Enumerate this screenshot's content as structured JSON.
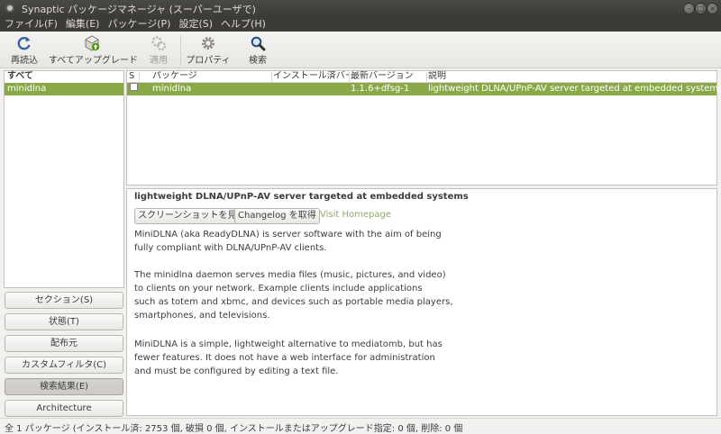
{
  "window": {
    "title": "Synaptic パッケージマネージャ (スーパーユーザで)"
  },
  "menu": [
    "ファイル(F)",
    "編集(E)",
    "パッケージ(P)",
    "設定(S)",
    "ヘルプ(H)"
  ],
  "toolbar": {
    "reload": "再読込",
    "upgrade_all": "すべてアップグレード",
    "apply": "適用",
    "properties": "プロパティ",
    "search": "検索"
  },
  "left": {
    "header": "すべて",
    "items": [
      "minidlna"
    ],
    "buttons": {
      "sections": "セクション(S)",
      "status": "状態(T)",
      "origin": "配布元",
      "custom": "カスタムフィルタ(C)",
      "search_results": "検索結果(E)",
      "architecture": "Architecture"
    }
  },
  "table": {
    "columns": {
      "s": "S",
      "package": "パッケージ",
      "installed": "インストール済バージ",
      "latest": "最新バージョン",
      "description": "説明"
    },
    "rows": [
      {
        "package": "minidlna",
        "installed": "",
        "latest": "1.1.6+dfsg-1",
        "description": "lightweight DLNA/UPnP-AV server targeted at embedded systems"
      }
    ]
  },
  "details": {
    "title": "lightweight DLNA/UPnP-AV server targeted at embedded systems",
    "screenshot_button": "スクリーンショットを見る",
    "changelog_button": "Changelog を取得",
    "homepage_link": "Visit Homepage",
    "paragraph1": "MiniDLNA (aka ReadyDLNA) is server software with the aim of being\nfully compliant with DLNA/UPnP-AV clients.",
    "paragraph2": "The minidlna daemon serves media files (music, pictures, and video)\nto clients on your network.  Example clients include applications\nsuch as totem and xbmc, and devices such as portable media players,\nsmartphones, and televisions.",
    "paragraph3": "MiniDLNA is a simple, lightweight alternative to mediatomb, but has\nfewer features. It does not have a web interface for administration\nand must be configured by editing a text file."
  },
  "status": "全 1 パッケージ (インストール済: 2753 個, 破損 0 個, インストールまたはアップグレード指定: 0 個, 削除: 0 個",
  "colors": {
    "selection": "#89a948",
    "titlebar": "#3c3b37",
    "link": "#8fa96a"
  }
}
